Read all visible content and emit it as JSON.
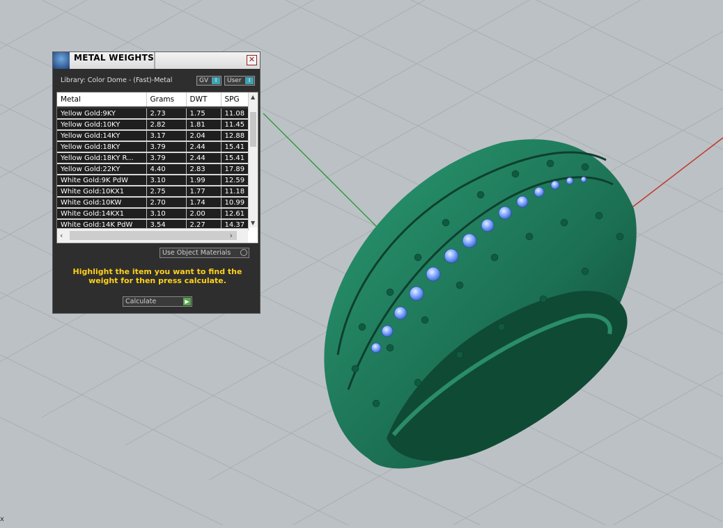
{
  "panel": {
    "title": "METAL WEIGHTS",
    "close_glyph": "✕",
    "library_label": "Library: Color Dome - (Fast)-Metal",
    "gv_label": "GV",
    "user_label": "User",
    "toggle_glyph": "I",
    "columns": [
      "Metal",
      "Grams",
      "DWT",
      "SPG"
    ],
    "rows": [
      [
        "Yellow Gold:9KY",
        "2.73",
        "1.75",
        "11.08"
      ],
      [
        "Yellow Gold:10KY",
        "2.82",
        "1.81",
        "11.45"
      ],
      [
        "Yellow Gold:14KY",
        "3.17",
        "2.04",
        "12.88"
      ],
      [
        "Yellow Gold:18KY",
        "3.79",
        "2.44",
        "15.41"
      ],
      [
        "Yellow Gold:18KY R...",
        "3.79",
        "2.44",
        "15.41"
      ],
      [
        "Yellow Gold:22KY",
        "4.40",
        "2.83",
        "17.89"
      ],
      [
        "White Gold:9K PdW",
        "3.10",
        "1.99",
        "12.59"
      ],
      [
        "White Gold:10KX1",
        "2.75",
        "1.77",
        "11.18"
      ],
      [
        "White Gold:10KW",
        "2.70",
        "1.74",
        "10.99"
      ],
      [
        "White Gold:14KX1",
        "3.10",
        "2.00",
        "12.61"
      ],
      [
        "White Gold:14K PdW",
        "3.54",
        "2.27",
        "14.37"
      ]
    ],
    "use_object_materials_label": "Use Object Materials",
    "instruction": "Highlight the item you want to find the weight for then press calculate.",
    "calculate_label": "Calculate",
    "calculate_glyph": "▶"
  },
  "viewport": {
    "corner_label": "x",
    "axis_colors": {
      "x": "#c0392b",
      "y": "#2e9b3a"
    },
    "ring_color": "#1f7a5a",
    "gem_color": "#7fa8ff"
  }
}
